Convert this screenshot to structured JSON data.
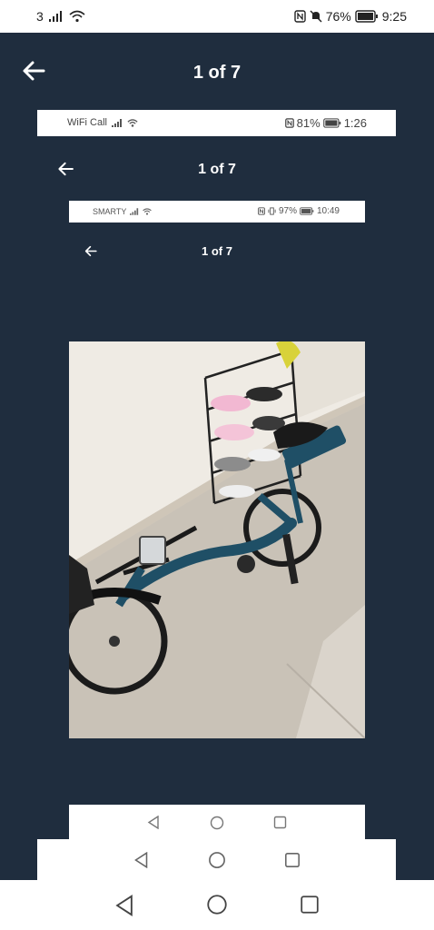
{
  "status_bar": {
    "sim": "3",
    "battery": "76%",
    "time": "9:25"
  },
  "viewer": {
    "title": "1 of 7",
    "nested1": {
      "carrier": "WiFi Call",
      "battery": "81%",
      "time": "1:26",
      "title": "1 of 7"
    },
    "nested2": {
      "carrier": "SMARTY",
      "battery": "97%",
      "time": "10:49",
      "title": "1 of 7"
    },
    "photo_alt": "Blue folding electric bike with shoe rack in background"
  },
  "icons": {
    "back": "arrow-left-icon",
    "nav_back": "triangle-back-icon",
    "nav_home": "circle-home-icon",
    "nav_recent": "square-recent-icon"
  },
  "colors": {
    "viewer_bg": "#1f2d3e",
    "text": "#ffffff"
  }
}
